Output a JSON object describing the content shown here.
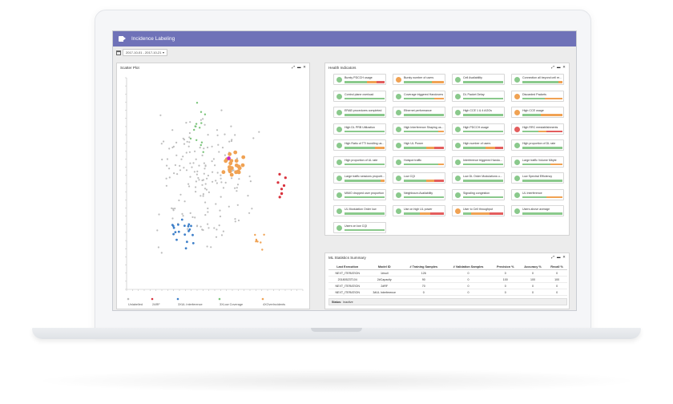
{
  "app": {
    "title": "Incidence Labeling",
    "date_range": "2017-10-01 - 2017-10-21"
  },
  "scatter_panel": {
    "title": "Scatter Plot",
    "legend": [
      "Unlabelled",
      "2ARF",
      "3XUL Interference",
      "3XLow Coverage",
      "4XOverIncidents"
    ],
    "colors": {
      "gray": "#bdbdbd",
      "orange": "#f0a253",
      "blue": "#3d7fc9",
      "green": "#7ac47a",
      "red": "#d9323d",
      "magenta": "#c228c9"
    }
  },
  "health_panel": {
    "title": "Health Indicators",
    "cards": [
      {
        "label": "Bursty PDCCH usage",
        "dot": "#8ac98c",
        "bar": [
          0.55,
          0.25,
          0.2
        ]
      },
      {
        "label": "Bursty number of users",
        "dot": "#f0a253",
        "bar": [
          0.7,
          0.3,
          0
        ]
      },
      {
        "label": "Cell Availability",
        "dot": "#8ac98c",
        "bar": [
          1,
          0,
          0
        ]
      },
      {
        "label": "Connection all beyond cell re...",
        "dot": "#8ac98c",
        "bar": [
          0.9,
          0.1,
          0
        ]
      },
      {
        "label": "Control plane overload",
        "dot": "#8ac98c",
        "bar": [
          1,
          0,
          0
        ]
      },
      {
        "label": "Coverage triggered Handovers",
        "dot": "#8ac98c",
        "bar": [
          0.75,
          0.25,
          0
        ]
      },
      {
        "label": "DL Packet Delay",
        "dot": "#8ac98c",
        "bar": [
          1,
          0,
          0
        ]
      },
      {
        "label": "Discarded Packets",
        "dot": "#f0a253",
        "bar": [
          0.55,
          0.45,
          0
        ]
      },
      {
        "label": "ERAB procedures completed",
        "dot": "#8ac98c",
        "bar": [
          1,
          0,
          0
        ]
      },
      {
        "label": "Ethernet performance",
        "dot": "#8ac98c",
        "bar": [
          1,
          0,
          0
        ]
      },
      {
        "label": "High CCE 1 & 4 AGGs",
        "dot": "#8ac98c",
        "bar": [
          1,
          0,
          0
        ]
      },
      {
        "label": "High CCE usage",
        "dot": "#f0a253",
        "bar": [
          0.45,
          0.55,
          0
        ]
      },
      {
        "label": "High DL PRB Utilization",
        "dot": "#8ac98c",
        "bar": [
          1,
          0,
          0
        ]
      },
      {
        "label": "High Interference Shaping us...",
        "dot": "#8ac98c",
        "bar": [
          0.85,
          0.15,
          0
        ]
      },
      {
        "label": "High PDCCH usage",
        "dot": "#8ac98c",
        "bar": [
          1,
          0,
          0
        ]
      },
      {
        "label": "High RRC reestablishments",
        "dot": "#e35d5d",
        "bar": [
          0.4,
          0.2,
          0.4
        ]
      },
      {
        "label": "High Ratio of TTI bundling us...",
        "dot": "#8ac98c",
        "bar": [
          0.75,
          0.25,
          0
        ]
      },
      {
        "label": "High UL Power",
        "dot": "#8ac98c",
        "bar": [
          0.55,
          0.2,
          0.25
        ]
      },
      {
        "label": "High number of users",
        "dot": "#8ac98c",
        "bar": [
          0.55,
          0.25,
          0.2
        ]
      },
      {
        "label": "High proportion of DL rate",
        "dot": "#8ac98c",
        "bar": [
          1,
          0,
          0
        ]
      },
      {
        "label": "High proportion of UL rate",
        "dot": "#8ac98c",
        "bar": [
          1,
          0,
          0
        ]
      },
      {
        "label": "Hotspot traffic",
        "dot": "#8ac98c",
        "bar": [
          0.85,
          0.15,
          0
        ]
      },
      {
        "label": "Interference triggered Hando...",
        "dot": "#8ac98c",
        "bar": [
          1,
          0,
          0
        ]
      },
      {
        "label": "Large traffic Volume Mbyte",
        "dot": "#8ac98c",
        "bar": [
          0.7,
          0.3,
          0
        ]
      },
      {
        "label": "Large traffic sessions proporti...",
        "dot": "#8ac98c",
        "bar": [
          0.9,
          0.1,
          0
        ]
      },
      {
        "label": "Low CQI",
        "dot": "#8ac98c",
        "bar": [
          0.55,
          0.2,
          0.25
        ]
      },
      {
        "label": "Low DL Order Modulations u...",
        "dot": "#8ac98c",
        "bar": [
          1,
          0,
          0
        ]
      },
      {
        "label": "Low Spectral Efficiency",
        "dot": "#8ac98c",
        "bar": [
          1,
          0,
          0
        ]
      },
      {
        "label": "MIMO dropped user proportion",
        "dot": "#8ac98c",
        "bar": [
          1,
          0,
          0
        ]
      },
      {
        "label": "Neighbours Availability",
        "dot": "#8ac98c",
        "bar": [
          1,
          0,
          0
        ]
      },
      {
        "label": "Signaling congestion",
        "dot": "#8ac98c",
        "bar": [
          1,
          0,
          0
        ]
      },
      {
        "label": "UL Interference",
        "dot": "#8ac98c",
        "bar": [
          0.6,
          0.4,
          0
        ]
      },
      {
        "label": "UL Modulation Order low",
        "dot": "#8ac98c",
        "bar": [
          1,
          0,
          0
        ]
      },
      {
        "label": "Use on high UL power",
        "dot": "#8ac98c",
        "bar": [
          0.4,
          0.25,
          0.35
        ]
      },
      {
        "label": "User to Cell throughput",
        "dot": "#f0a253",
        "bar": [
          0.2,
          0.45,
          0.35
        ]
      },
      {
        "label": "Users above average",
        "dot": "#8ac98c",
        "bar": [
          1,
          0,
          0
        ]
      },
      {
        "label": "Users on low CQI",
        "dot": "#8ac98c",
        "bar": [
          1,
          0,
          0
        ]
      }
    ]
  },
  "ml_panel": {
    "title": "ML Statistics Summary",
    "columns": [
      "Last Execution",
      "Model ID",
      "# Training Samples",
      "# Validation Samples",
      "Precision %",
      "Accuracy %",
      "Recall %"
    ],
    "rows": [
      [
        "NEXT_ITERATION",
        "1#null",
        "126",
        "0",
        "0",
        "0",
        "0"
      ],
      [
        "20180523T104",
        "2#Capacity",
        "90",
        "0",
        "100",
        "100",
        "100"
      ],
      [
        "NEXT_ITERATION",
        "2#RF",
        "70",
        "0",
        "0",
        "0",
        "0"
      ],
      [
        "NEXT_ITERATION",
        "3#UL Interference",
        "0",
        "0",
        "0",
        "0",
        "0"
      ]
    ],
    "status_label": "Status:",
    "status_value": "Inactive"
  },
  "bar_colors": {
    "good": "#8ac98c",
    "warn": "#f0a253",
    "bad": "#e35d5d"
  }
}
